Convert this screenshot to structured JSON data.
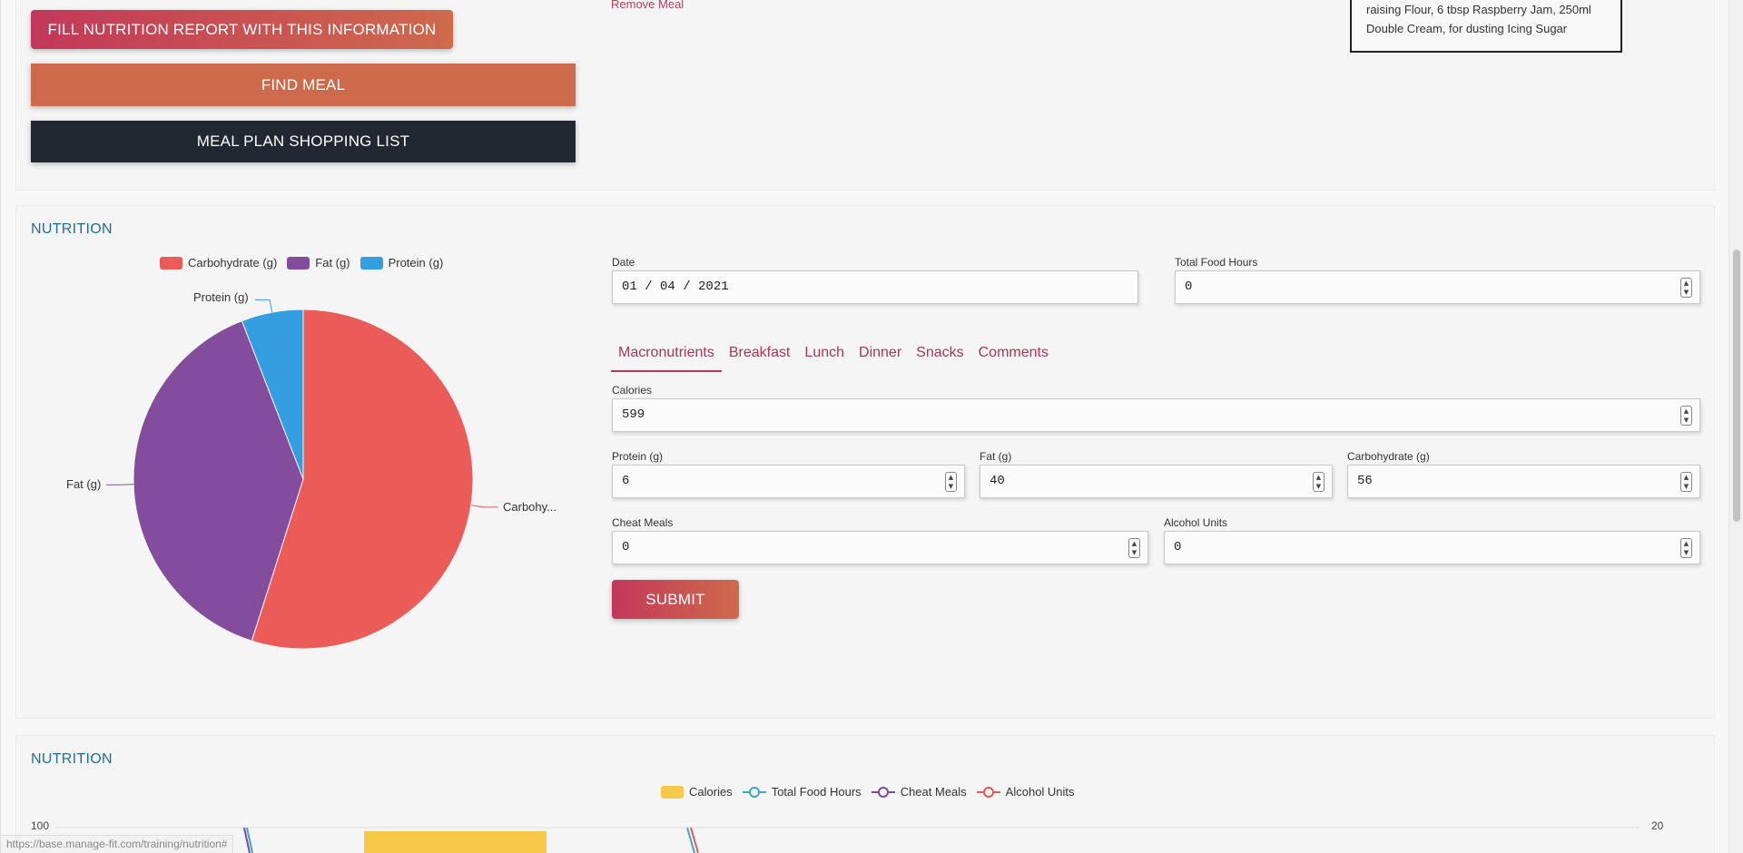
{
  "top": {
    "fill_report_label": "FILL NUTRITION REPORT WITH THIS INFORMATION",
    "find_meal_label": "FIND MEAL",
    "shopping_list_label": "MEAL PLAN SHOPPING LIST",
    "remove_meal_label": "Remove Meal",
    "recipe_line1": "raising Flour, 6 tbsp Raspberry Jam, 250ml",
    "recipe_line2": "Double Cream, for dusting Icing Sugar"
  },
  "nutrition": {
    "title": "NUTRITION",
    "pie_labels": {
      "protein": "Protein (g)",
      "fat": "Fat (g)",
      "carbohydrate": "Carbohy..."
    },
    "form": {
      "date_label": "Date",
      "date_value": "01 / 04 / 2021",
      "food_hours_label": "Total Food Hours",
      "food_hours_value": "0",
      "tabs": [
        "Macronutrients",
        "Breakfast",
        "Lunch",
        "Dinner",
        "Snacks",
        "Comments"
      ],
      "calories_label": "Calories",
      "calories_value": "599",
      "protein_label": "Protein (g)",
      "protein_value": "6",
      "fat_label": "Fat (g)",
      "fat_value": "40",
      "carb_label": "Carbohydrate (g)",
      "carb_value": "56",
      "cheat_label": "Cheat Meals",
      "cheat_value": "0",
      "alcohol_label": "Alcohol Units",
      "alcohol_value": "0",
      "submit_label": "SUBMIT"
    }
  },
  "chart_data": [
    {
      "type": "pie",
      "series": [
        {
          "name": "Carbohydrate (g)",
          "value": 56,
          "color": "#eb5b57"
        },
        {
          "name": "Fat (g)",
          "value": 40,
          "color": "#844c9d"
        },
        {
          "name": "Protein (g)",
          "value": 6,
          "color": "#339ee0"
        }
      ],
      "legend": "top"
    },
    {
      "type": "bar",
      "series": [
        {
          "name": "Calories",
          "color": "#f7c948"
        },
        {
          "name": "Total Food Hours",
          "color": "#3ba7c9"
        },
        {
          "name": "Cheat Meals",
          "color": "#7a4a94"
        },
        {
          "name": "Alcohol Units",
          "color": "#e05a5a"
        }
      ],
      "y_left_top_tick": "100",
      "y_right_top_tick": "20",
      "legend": "top"
    }
  ],
  "nutrition2": {
    "title": "NUTRITION"
  },
  "status": {
    "url": "https://base.manage-fit.com/training/nutrition#"
  }
}
